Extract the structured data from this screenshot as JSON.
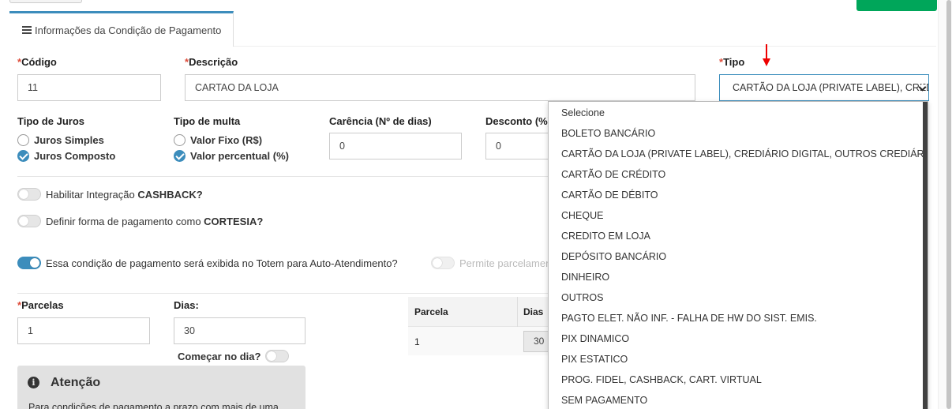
{
  "tab": {
    "label": "Informações da Condição de Pagamento"
  },
  "form": {
    "codigo": {
      "label": "Código",
      "value": "11"
    },
    "descricao": {
      "label": "Descrição",
      "value": "CARTAO DA LOJA"
    },
    "tipo": {
      "label": "Tipo",
      "value": "CARTÃO DA LOJA (PRIVATE LABEL), CREDIÁRIO DIGITAL, OUTROS CREDIÁRIOS"
    },
    "tipo_juros": {
      "label": "Tipo de Juros",
      "options": [
        "Juros Simples",
        "Juros Composto"
      ],
      "selected": "Juros Composto"
    },
    "tipo_multa": {
      "label": "Tipo de multa",
      "options": [
        "Valor Fixo (R$)",
        "Valor percentual (%)"
      ],
      "selected": "Valor percentual (%)"
    },
    "carencia": {
      "label": "Carência (Nº de dias)",
      "value": "0"
    },
    "desconto": {
      "label": "Desconto (%)",
      "value": "0"
    },
    "cashback": {
      "prefix": "Habilitar Integração ",
      "bold": "CASHBACK?"
    },
    "cortesia": {
      "prefix": "Definir forma de pagamento como ",
      "bold": "CORTESIA?"
    },
    "totem": {
      "label": "Essa condição de pagamento será exibida no Totem para Auto-Atendimento?"
    },
    "parcelamento": {
      "label": "Permite parcelamento"
    },
    "parcelas": {
      "label": "Parcelas",
      "value": "1"
    },
    "dias": {
      "label": "Dias:",
      "value": "30"
    },
    "comecar": {
      "label": "Começar no dia?"
    },
    "required_mark": "*"
  },
  "table": {
    "headers": [
      "Parcela",
      "Dias"
    ],
    "rows": [
      [
        "1",
        "30"
      ]
    ]
  },
  "attention": {
    "icon": "info-circle-icon",
    "title": "Atenção",
    "text": "Para condições de pagamento a prazo com mais de uma"
  },
  "dropdown": {
    "options": [
      "Selecione",
      "BOLETO BANCÁRIO",
      "CARTÃO DA LOJA (PRIVATE LABEL), CREDIÁRIO DIGITAL, OUTROS CREDIÁRIOS",
      "CARTÃO DE CRÉDITO",
      "CARTÃO DE DÉBITO",
      "CHEQUE",
      "CREDITO EM LOJA",
      "DEPÓSITO BANCÁRIO",
      "DINHEIRO",
      "OUTROS",
      "PAGTO ELET. NÃO INF. - FALHA DE HW DO SIST. EMIS.",
      "PIX DINAMICO",
      "PIX ESTATICO",
      "PROG. FIDEL, CASHBACK, CART. VIRTUAL",
      "SEM PAGAMENTO"
    ]
  },
  "colors": {
    "accent": "#3c8dbc",
    "required": "#dd4b39",
    "annotation_arrow": "#ee0000",
    "success": "#00a65a"
  }
}
